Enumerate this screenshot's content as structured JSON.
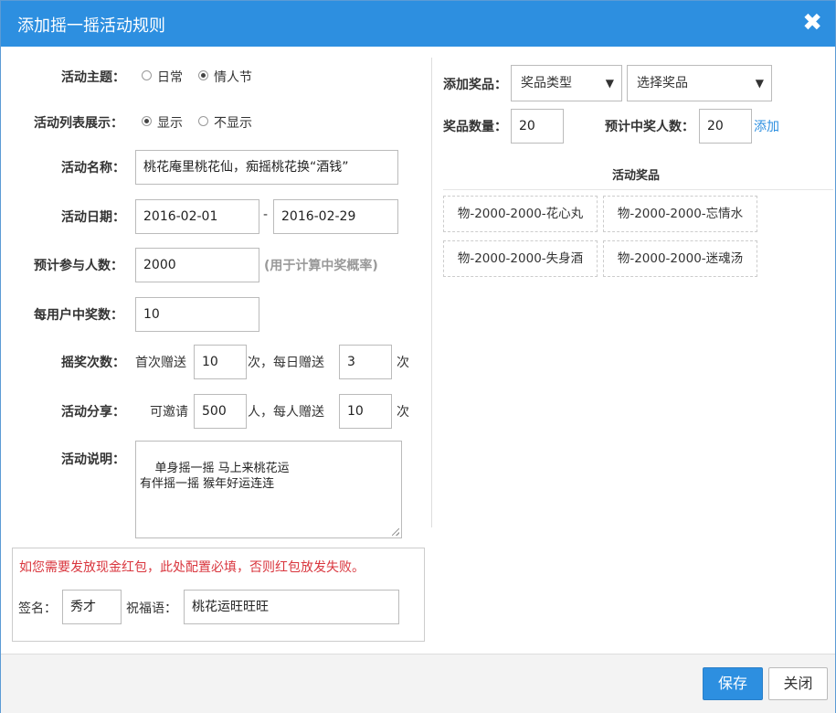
{
  "dialog": {
    "title": "添加摇一摇活动规则",
    "close_glyph": "✖"
  },
  "form": {
    "theme": {
      "label": "活动主题：",
      "options": [
        "日常",
        "情人节"
      ],
      "selected": "情人节"
    },
    "list_display": {
      "label": "活动列表展示：",
      "options": [
        "显示",
        "不显示"
      ],
      "selected": "显示"
    },
    "name": {
      "label": "活动名称：",
      "value": "桃花庵里桃花仙，痴摇桃花换“酒钱”"
    },
    "date": {
      "label": "活动日期：",
      "start": "2016-02-01",
      "separator": "-",
      "end": "2016-02-29"
    },
    "participants": {
      "label": "预计参与人数：",
      "value": "2000",
      "hint": "(用于计算中奖概率)"
    },
    "per_user_wins": {
      "label": "每用户中奖数：",
      "value": "10"
    },
    "shake_times": {
      "label": "摇奖次数：",
      "prefix": "首次赠送",
      "first_value": "10",
      "middle": "次，每日赠送",
      "daily_value": "3",
      "suffix": "次"
    },
    "share": {
      "label": "活动分享：",
      "prefix": "可邀请",
      "invite_value": "500",
      "middle": "人，每人赠送",
      "gift_value": "10",
      "suffix": "次"
    },
    "description": {
      "label": "活动说明：",
      "value": "单身摇一摇 马上来桃花运\n有伴摇一摇 猴年好运连连"
    }
  },
  "redpacket": {
    "warning": "如您需要发放现金红包，此处配置必填，否则红包放发失败。",
    "signature_label": "签名：",
    "signature_value": "秀才",
    "blessing_label": "祝福语：",
    "blessing_value": "桃花运旺旺旺"
  },
  "prizes": {
    "add_label": "添加奖品：",
    "type_select": "奖品类型",
    "prize_select": "选择奖品",
    "arrow": "▼",
    "qty_label": "奖品数量：",
    "qty_value": "20",
    "winners_label": "预计中奖人数：",
    "winners_value": "20",
    "add_link": "添加",
    "section_title": "活动奖品",
    "items": [
      "物-2000-2000-花心丸",
      "物-2000-2000-忘情水",
      "物-2000-2000-失身酒",
      "物-2000-2000-迷魂汤"
    ]
  },
  "footer": {
    "save": "保存",
    "close": "关闭"
  },
  "colors": {
    "accent": "#2d8fe0",
    "warning": "#d9363e"
  }
}
